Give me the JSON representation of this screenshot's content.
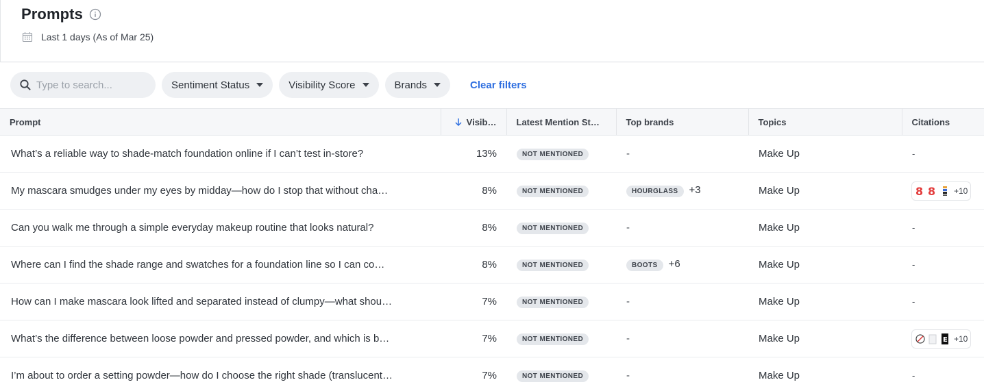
{
  "header": {
    "title": "Prompts",
    "date_range": "Last 1 days (As of Mar 25)"
  },
  "filters": {
    "search_placeholder": "Type to search...",
    "chips": [
      "Sentiment Status",
      "Visibility Score",
      "Brands"
    ],
    "clear_label": "Clear filters"
  },
  "table": {
    "columns": [
      "Prompt",
      "Visib…",
      "Latest Mention St…",
      "Top brands",
      "Topics",
      "Citations"
    ],
    "rows": [
      {
        "prompt": "What’s a reliable way to shade-match foundation online if I can’t test in-store?",
        "visibility": "13%",
        "status": "NOT MENTIONED",
        "brand": "",
        "brand_more": "",
        "brand_dash": "-",
        "topic": "Make Up",
        "citations": "",
        "citations_dash": "-"
      },
      {
        "prompt": "My mascara smudges under my eyes by midday—how do I stop that without changing my routine?",
        "visibility": "8%",
        "status": "NOT MENTIONED",
        "brand": "HOURGLASS",
        "brand_more": "+3",
        "brand_dash": "",
        "topic": "Make Up",
        "citations": "+10",
        "citations_dash": ""
      },
      {
        "prompt": "Can you walk me through a simple everyday makeup routine that looks natural?",
        "visibility": "8%",
        "status": "NOT MENTIONED",
        "brand": "",
        "brand_more": "",
        "brand_dash": "-",
        "topic": "Make Up",
        "citations": "",
        "citations_dash": "-"
      },
      {
        "prompt": "Where can I find the shade range and swatches for a foundation line so I can compare?",
        "visibility": "8%",
        "status": "NOT MENTIONED",
        "brand": "BOOTS",
        "brand_more": "+6",
        "brand_dash": "",
        "topic": "Make Up",
        "citations": "",
        "citations_dash": "-"
      },
      {
        "prompt": "How can I make mascara look lifted and separated instead of clumpy—what should I do?",
        "visibility": "7%",
        "status": "NOT MENTIONED",
        "brand": "",
        "brand_more": "",
        "brand_dash": "-",
        "topic": "Make Up",
        "citations": "",
        "citations_dash": "-"
      },
      {
        "prompt": "What’s the difference between loose powder and pressed powder, and which is better?",
        "visibility": "7%",
        "status": "NOT MENTIONED",
        "brand": "",
        "brand_more": "",
        "brand_dash": "-",
        "topic": "Make Up",
        "citations": "+10",
        "citations_dash": ""
      },
      {
        "prompt": "I’m about to order a setting powder—how do I choose the right shade (translucent or tinted)?",
        "visibility": "7%",
        "status": "NOT MENTIONED",
        "brand": "",
        "brand_more": "",
        "brand_dash": "-",
        "topic": "Make Up",
        "citations": "",
        "citations_dash": "-"
      }
    ]
  },
  "icons": {
    "title_info": "info-icon",
    "date": "calendar-icon",
    "search": "search-icon",
    "sort": "arrow-down-icon"
  },
  "colors": {
    "accent": "#2f6fe0",
    "badge_bg": "#e4e7eb",
    "chip_bg": "#eef0f3"
  }
}
